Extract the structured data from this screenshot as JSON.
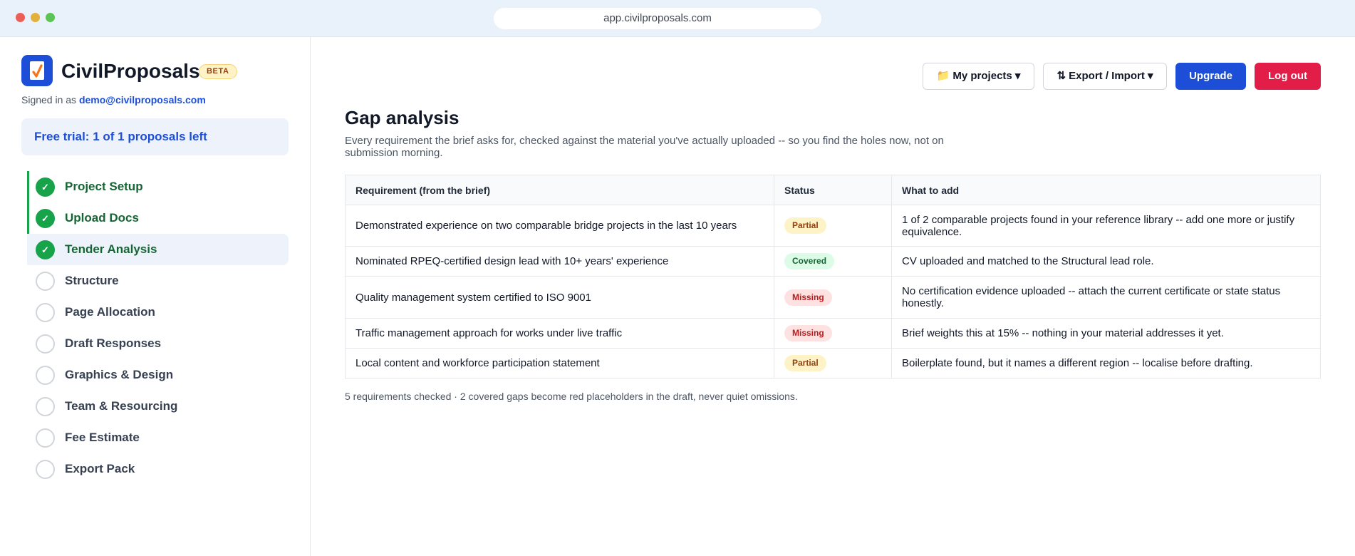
{
  "browser": {
    "url": "app.civilproposals.com"
  },
  "sidebar": {
    "brand": "CivilProposals",
    "badge": "BETA",
    "signed_in_prefix": "Signed in as",
    "email": "demo@civilproposals.com",
    "trial": "Free trial: 1 of 1 proposals left",
    "steps": [
      {
        "label": "Project Setup",
        "status": "done",
        "check": "✓"
      },
      {
        "label": "Upload Docs",
        "status": "done",
        "check": "✓"
      },
      {
        "label": "Tender Analysis",
        "status": "done",
        "check": "✓",
        "active": true
      },
      {
        "label": "Structure",
        "status": "pending"
      },
      {
        "label": "Page Allocation",
        "status": "pending"
      },
      {
        "label": "Draft Responses",
        "status": "pending"
      },
      {
        "label": "Graphics & Design",
        "status": "pending"
      },
      {
        "label": "Team & Resourcing",
        "status": "pending"
      },
      {
        "label": "Fee Estimate",
        "status": "pending"
      },
      {
        "label": "Export Pack",
        "status": "pending"
      }
    ]
  },
  "toolbar": {
    "projects_label": "📁 My projects ▾",
    "export_label": "⇅ Export / Import ▾",
    "upgrade_label": "Upgrade",
    "logout_label": "Log out"
  },
  "main": {
    "title": "Gap analysis",
    "subtitle": "Every requirement the brief asks for, checked against the material you've actually uploaded -- so you find the holes now, not on submission morning.",
    "table": {
      "headers": [
        "Requirement (from the brief)",
        "Status",
        "What to add"
      ],
      "rows": [
        {
          "requirement": "Demonstrated experience on two comparable bridge projects in the last 10 years",
          "status": "Partial",
          "action": "1 of 2 comparable projects found in your reference library -- add one more or justify equivalence."
        },
        {
          "requirement": "Nominated RPEQ-certified design lead with 10+ years' experience",
          "status": "Covered",
          "action": "CV uploaded and matched to the Structural lead role."
        },
        {
          "requirement": "Quality management system certified to ISO 9001",
          "status": "Missing",
          "action": "No certification evidence uploaded -- attach the current certificate or state status honestly."
        },
        {
          "requirement": "Traffic management approach for works under live traffic",
          "status": "Missing",
          "action": "Brief weights this at 15% -- nothing in your material addresses it yet."
        },
        {
          "requirement": "Local content and workforce participation statement",
          "status": "Partial",
          "action": "Boilerplate found, but it names a different region -- localise before drafting."
        }
      ]
    },
    "footer": "5 requirements checked · 2 covered gaps become red placeholders in the draft, never quiet omissions."
  },
  "colors": {
    "accent": "#1d4ed8",
    "danger": "#e11d48",
    "success": "#16a34a",
    "partial": "#fef3c7",
    "covered": "#dcfce7",
    "missing": "#fee2e2"
  }
}
